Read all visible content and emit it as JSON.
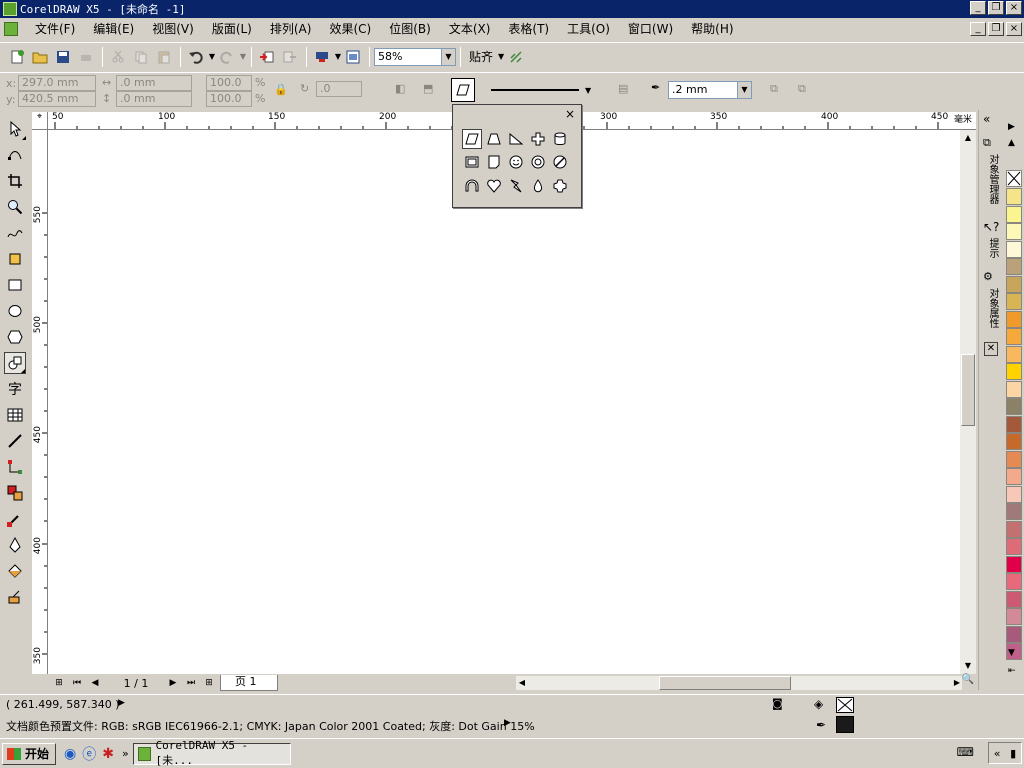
{
  "window": {
    "title": "CorelDRAW X5 - [未命名 -1]",
    "minimize": "_",
    "restore": "❐",
    "close": "×"
  },
  "menu": [
    "文件(F)",
    "编辑(E)",
    "视图(V)",
    "版面(L)",
    "排列(A)",
    "效果(C)",
    "位图(B)",
    "文本(X)",
    "表格(T)",
    "工具(O)",
    "窗口(W)",
    "帮助(H)"
  ],
  "toolbar": {
    "zoom_value": "58%",
    "snap_label": "贴齐"
  },
  "property_bar": {
    "x_label": "x:",
    "x_value": "297.0 mm",
    "y_label": "y:",
    "y_value": "420.5 mm",
    "w_value": ".0 mm",
    "h_value": ".0 mm",
    "scale_x": "100.0",
    "scale_y": "100.0",
    "percent": "%",
    "rotation": ".0",
    "outline_width": ".2 mm"
  },
  "ruler": {
    "unit": "毫米",
    "h_ticks": [
      "50",
      "100",
      "150",
      "200",
      "250",
      "300",
      "350",
      "400",
      "450"
    ],
    "v_ticks": [
      "550",
      "500",
      "450",
      "400",
      "350"
    ],
    "v_unit": "毫米"
  },
  "page_nav": {
    "count": "1 / 1",
    "tab": "页 1"
  },
  "flyout": {
    "close": "×",
    "rows": [
      [
        "parallelogram-icon",
        "trapezoid-icon",
        "right-triangle-icon",
        "cross-icon",
        "cylinder-icon"
      ],
      [
        "frame-icon",
        "folded-corner-icon",
        "smiley-icon",
        "donut-icon",
        "no-symbol-icon"
      ],
      [
        "arch-icon",
        "heart-icon",
        "lightning-icon",
        "teardrop-icon",
        "octagon-cross-icon"
      ]
    ]
  },
  "dockers": {
    "object_manager": "对象管理器",
    "hints": "提示",
    "object_props": "对象属性"
  },
  "palette": [
    "#ffffff",
    "#f5e58a",
    "#fbf58f",
    "#fcf8b8",
    "#fdf9d8",
    "#b9a27a",
    "#c7a65c",
    "#d7b454",
    "#f09a2c",
    "#f5a93a",
    "#f9b85e",
    "#ffd200",
    "#fcd5a5",
    "#8b8166",
    "#a45a3a",
    "#c66a2c",
    "#e48a52",
    "#f3a98c",
    "#f7c8b7",
    "#a07a7a",
    "#c27070",
    "#dd6c78",
    "#e0004a",
    "#e8687c",
    "#cc5a72",
    "#d38a98",
    "#a85a7a",
    "#c0608a"
  ],
  "status": {
    "coords": "( 261.499, 587.340 )",
    "color_profile": "文档颜色预置文件: RGB: sRGB IEC61966-2.1; CMYK: Japan Color 2001 Coated; 灰度: Dot Gain 15%"
  },
  "taskbar": {
    "start": "开始",
    "task": "CorelDRAW X5 - [未..."
  },
  "colors": {
    "titlebar": "#0a246a",
    "chrome": "#d4d0c8",
    "canvas": "#ffffff"
  }
}
